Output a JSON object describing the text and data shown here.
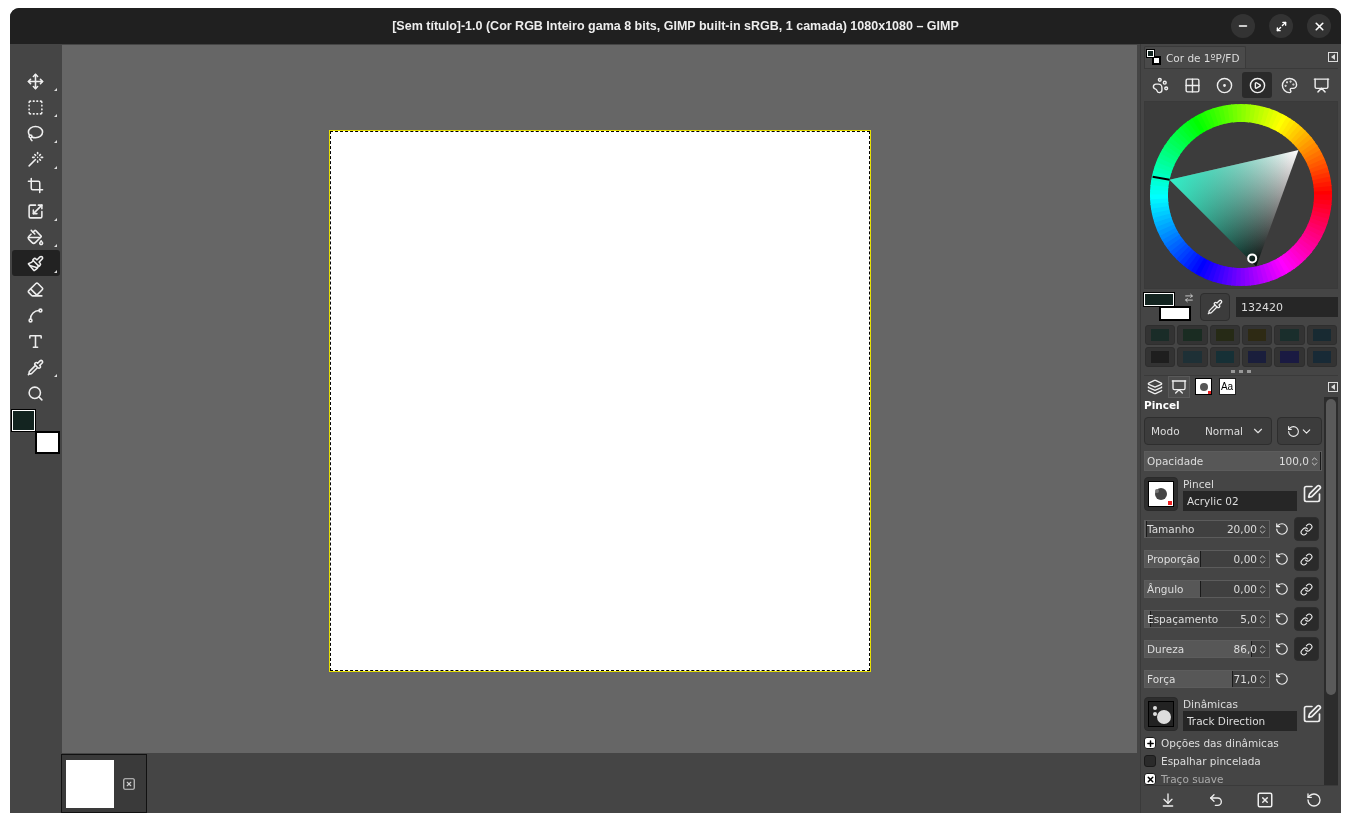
{
  "window": {
    "title": "[Sem título]-1.0 (Cor RGB Inteiro gama 8 bits, GIMP built-in sRGB, 1 camada) 1080x1080 – GIMP"
  },
  "toolbox": {
    "tools": [
      {
        "selected": false,
        "submenu": true
      },
      {
        "selected": false,
        "submenu": true
      },
      {
        "selected": false,
        "submenu": true
      },
      {
        "selected": false,
        "submenu": true
      },
      {
        "selected": false,
        "submenu": false
      },
      {
        "selected": false,
        "submenu": true
      },
      {
        "selected": false,
        "submenu": true
      },
      {
        "selected": true,
        "submenu": true
      },
      {
        "selected": false,
        "submenu": false
      },
      {
        "selected": false,
        "submenu": false
      },
      {
        "selected": false,
        "submenu": false
      },
      {
        "selected": false,
        "submenu": true
      },
      {
        "selected": false,
        "submenu": false
      }
    ],
    "swatches": [
      {
        "kind": "foreground",
        "color": "#132420"
      },
      {
        "kind": "background",
        "color": "#ffffff"
      }
    ]
  },
  "image_tabs": [
    {
      "selected": true
    }
  ],
  "color_dock": {
    "tab": "Cor de 1ºP/FD",
    "selectors": [
      {
        "selected": false
      },
      {
        "selected": false
      },
      {
        "selected": false
      },
      {
        "selected": true
      },
      {
        "selected": false
      },
      {
        "selected": false
      }
    ],
    "swatches": [
      {
        "kind": "foreground",
        "color": "#132420"
      },
      {
        "kind": "background",
        "color": "#ffffff"
      }
    ],
    "hex": "132420",
    "history": [
      {
        "color": "#1a2c28"
      },
      {
        "color": "#1a2c22"
      },
      {
        "color": "#262a16"
      },
      {
        "color": "#2e2a14"
      },
      {
        "color": "#1a2e2c"
      },
      {
        "color": "#182a32"
      },
      {
        "color": "#1e1e1e"
      },
      {
        "color": "#1e3036"
      },
      {
        "color": "#163036"
      },
      {
        "color": "#1a1e3c"
      },
      {
        "color": "#1a1a42"
      },
      {
        "color": "#182a36"
      }
    ]
  },
  "tool_options": {
    "tabs": [
      {
        "selected": false
      },
      {
        "selected": true
      },
      {
        "selected": false
      },
      {
        "label": "Aa",
        "selected": false
      }
    ],
    "title": "Pincel",
    "mode_label": "Modo",
    "mode": "Normal",
    "opacity": {
      "label": "Opacidade",
      "value": "100,0",
      "level": 1
    },
    "brush": {
      "label": "Pincel",
      "value": "Acrylic 02"
    },
    "sliders": [
      {
        "label": "Tamanho",
        "value": "20,00",
        "level": 0.02,
        "has_link": true
      },
      {
        "label": "Proporção",
        "value": "0,00",
        "level": 0.45,
        "has_link": true
      },
      {
        "label": "Ângulo",
        "value": "0,00",
        "level": 0.45,
        "has_link": true
      },
      {
        "label": "Espaçamento",
        "value": "5,0",
        "level": 0.05,
        "has_link": true
      },
      {
        "label": "Dureza",
        "value": "86,0",
        "level": 0.86,
        "has_link": true
      },
      {
        "label": "Força",
        "value": "71,0",
        "level": 0.71,
        "has_link": false
      }
    ],
    "dynamics": {
      "label": "Dinâmicas",
      "value": "Track Direction"
    },
    "options": [
      {
        "kind": "expander",
        "label": "Opções das dinâmicas",
        "expanded": false
      },
      {
        "kind": "checkbox",
        "label": "Espalhar pincelada",
        "checked": false
      },
      {
        "kind": "checkbox",
        "label": "Traço suave",
        "checked": true
      }
    ]
  }
}
